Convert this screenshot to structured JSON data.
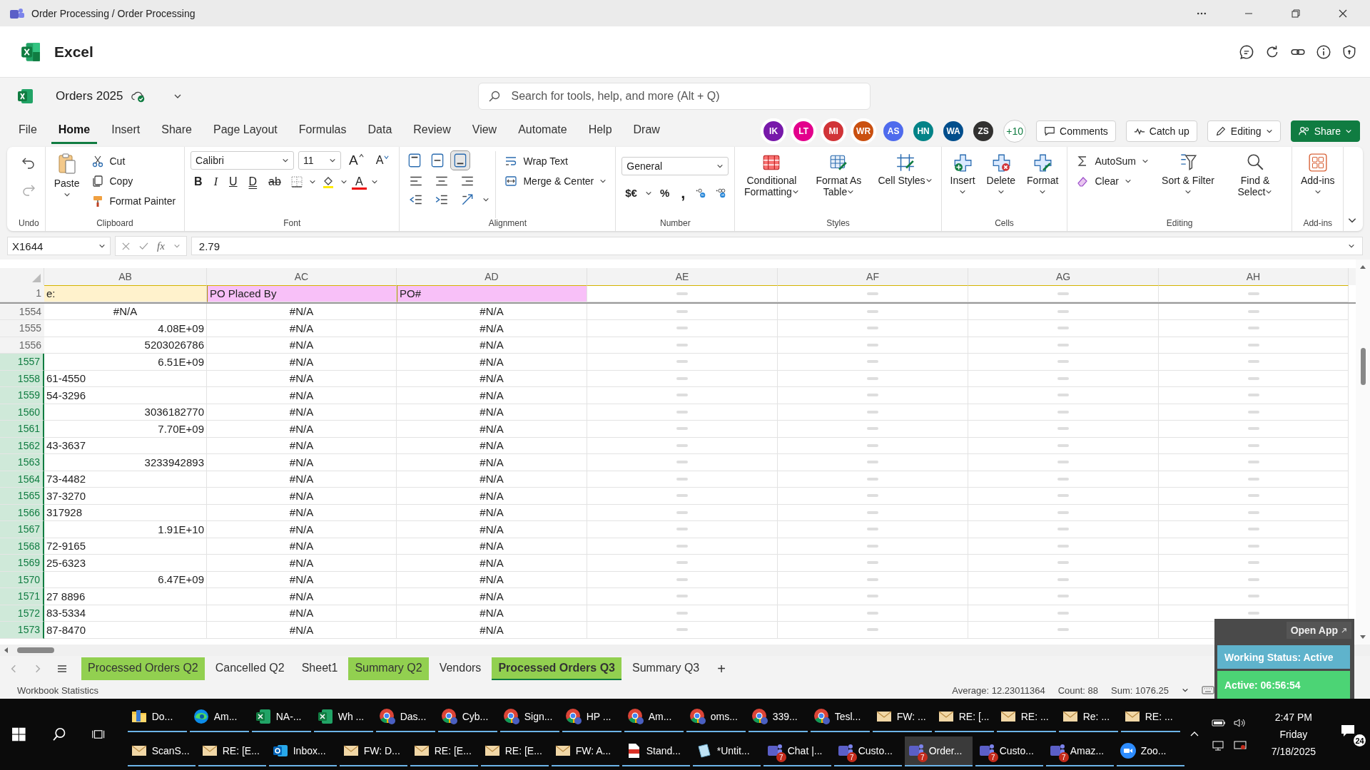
{
  "window": {
    "title": "Order Processing / Order Processing"
  },
  "app": {
    "name": "Excel"
  },
  "document": {
    "name": "Orders 2025"
  },
  "search": {
    "placeholder": "Search for tools, help, and more (Alt + Q)"
  },
  "menu_tabs": [
    {
      "label": "File",
      "selected": false
    },
    {
      "label": "Home",
      "selected": true
    },
    {
      "label": "Insert",
      "selected": false
    },
    {
      "label": "Share",
      "selected": false
    },
    {
      "label": "Page Layout",
      "selected": false
    },
    {
      "label": "Formulas",
      "selected": false
    },
    {
      "label": "Data",
      "selected": false
    },
    {
      "label": "Review",
      "selected": false
    },
    {
      "label": "View",
      "selected": false
    },
    {
      "label": "Automate",
      "selected": false
    },
    {
      "label": "Help",
      "selected": false
    },
    {
      "label": "Draw",
      "selected": false
    }
  ],
  "collaborators": [
    {
      "initials": "IK",
      "color": "#7719aa",
      "ring": true
    },
    {
      "initials": "LT",
      "color": "#e3008c",
      "ring": true
    },
    {
      "initials": "MI",
      "color": "#d13438",
      "ring": true
    },
    {
      "initials": "WR",
      "color": "#ca5010",
      "ring": true
    },
    {
      "initials": "AS",
      "color": "#4f6bed",
      "ring": false
    },
    {
      "initials": "HN",
      "color": "#038387",
      "ring": false
    },
    {
      "initials": "WA",
      "color": "#004e8c",
      "ring": false
    },
    {
      "initials": "ZS",
      "color": "#323130",
      "ring": false
    }
  ],
  "more_collaborators": "+10",
  "actions": {
    "comments": "Comments",
    "catch_up": "Catch up",
    "editing": "Editing",
    "share": "Share"
  },
  "ribbon": {
    "undo": {
      "label": "Undo"
    },
    "clipboard": {
      "label": "Clipboard",
      "paste": "Paste",
      "cut": "Cut",
      "copy": "Copy",
      "format_painter": "Format Painter"
    },
    "font": {
      "label": "Font",
      "family": "Calibri",
      "size": "11",
      "grow": "A",
      "shrink": "A",
      "styles": [
        "B",
        "I",
        "U",
        "D",
        "ab"
      ],
      "font_color": "A"
    },
    "alignment": {
      "label": "Alignment",
      "vertical": [
        {
          "selected": false
        },
        {
          "selected": false
        },
        {
          "selected": true
        }
      ],
      "wrap_text": "Wrap Text",
      "merge_center": "Merge & Center"
    },
    "number": {
      "label": "Number",
      "format": "General",
      "currency": "$€",
      "percent": "%",
      "comma": ","
    },
    "styles": {
      "label": "Styles",
      "items": [
        "Conditional Formatting",
        "Format As Table",
        "Cell Styles"
      ]
    },
    "cells": {
      "label": "Cells",
      "items": [
        "Insert",
        "Delete",
        "Format"
      ]
    },
    "editing": {
      "label": "Editing",
      "autosum": "AutoSum",
      "clear": "Clear",
      "sort_filter": "Sort & Filter",
      "find_select": "Find & Select"
    },
    "addins": {
      "label": "Add-ins",
      "button": "Add-ins"
    }
  },
  "formula_bar": {
    "name_box": "X1644",
    "fx": "fx",
    "value": "2.79"
  },
  "columns": [
    {
      "label": "AB"
    },
    {
      "label": "AC"
    },
    {
      "label": "AD"
    },
    {
      "label": "AE",
      "loading": true
    },
    {
      "label": "AF",
      "loading": true
    },
    {
      "label": "AG",
      "loading": true
    },
    {
      "label": "AH",
      "loading": true
    }
  ],
  "header_row": {
    "row": "1",
    "cells": [
      {
        "text": "e:",
        "color": "#fff2cc"
      },
      {
        "text": "PO Placed By",
        "color": "#f8c0f8"
      },
      {
        "text": "PO#",
        "color": "#f8c0f8"
      }
    ]
  },
  "rows": [
    {
      "row": "1554",
      "selected": false,
      "ab": {
        "text": "#N/A",
        "kind": "error"
      },
      "ac": "#N/A",
      "ad": "#N/A"
    },
    {
      "row": "1555",
      "selected": false,
      "ab": {
        "text": "4.08E+09",
        "kind": "number"
      },
      "ac": "#N/A",
      "ad": "#N/A"
    },
    {
      "row": "1556",
      "selected": false,
      "ab": {
        "text": "5203026786",
        "kind": "number"
      },
      "ac": "#N/A",
      "ad": "#N/A"
    },
    {
      "row": "1557",
      "selected": true,
      "ab": {
        "text": "6.51E+09",
        "kind": "number"
      },
      "ac": "#N/A",
      "ad": "#N/A"
    },
    {
      "row": "1558",
      "selected": true,
      "ab": {
        "text": "61-4550",
        "kind": "text"
      },
      "ac": "#N/A",
      "ad": "#N/A"
    },
    {
      "row": "1559",
      "selected": true,
      "ab": {
        "text": "54-3296",
        "kind": "text"
      },
      "ac": "#N/A",
      "ad": "#N/A"
    },
    {
      "row": "1560",
      "selected": true,
      "ab": {
        "text": "3036182770",
        "kind": "number"
      },
      "ac": "#N/A",
      "ad": "#N/A"
    },
    {
      "row": "1561",
      "selected": true,
      "ab": {
        "text": "7.70E+09",
        "kind": "number"
      },
      "ac": "#N/A",
      "ad": "#N/A"
    },
    {
      "row": "1562",
      "selected": true,
      "ab": {
        "text": "43-3637",
        "kind": "text"
      },
      "ac": "#N/A",
      "ad": "#N/A"
    },
    {
      "row": "1563",
      "selected": true,
      "ab": {
        "text": "3233942893",
        "kind": "number"
      },
      "ac": "#N/A",
      "ad": "#N/A"
    },
    {
      "row": "1564",
      "selected": true,
      "ab": {
        "text": "73-4482",
        "kind": "text"
      },
      "ac": "#N/A",
      "ad": "#N/A"
    },
    {
      "row": "1565",
      "selected": true,
      "ab": {
        "text": "37-3270",
        "kind": "text"
      },
      "ac": "#N/A",
      "ad": "#N/A"
    },
    {
      "row": "1566",
      "selected": true,
      "ab": {
        "text": "317928",
        "kind": "text"
      },
      "ac": "#N/A",
      "ad": "#N/A"
    },
    {
      "row": "1567",
      "selected": true,
      "ab": {
        "text": "1.91E+10",
        "kind": "number"
      },
      "ac": "#N/A",
      "ad": "#N/A"
    },
    {
      "row": "1568",
      "selected": true,
      "ab": {
        "text": "72-9165",
        "kind": "text"
      },
      "ac": "#N/A",
      "ad": "#N/A"
    },
    {
      "row": "1569",
      "selected": true,
      "ab": {
        "text": "25-6323",
        "kind": "text"
      },
      "ac": "#N/A",
      "ad": "#N/A"
    },
    {
      "row": "1570",
      "selected": true,
      "ab": {
        "text": "6.47E+09",
        "kind": "number"
      },
      "ac": "#N/A",
      "ad": "#N/A"
    },
    {
      "row": "1571",
      "selected": true,
      "ab": {
        "text": "27 8896",
        "kind": "text"
      },
      "ac": "#N/A",
      "ad": "#N/A"
    },
    {
      "row": "1572",
      "selected": true,
      "ab": {
        "text": "83-5334",
        "kind": "text"
      },
      "ac": "#N/A",
      "ad": "#N/A"
    },
    {
      "row": "1573",
      "selected": true,
      "ab": {
        "text": "87-8470",
        "kind": "text"
      },
      "ac": "#N/A",
      "ad": "#N/A"
    }
  ],
  "sheet_tabs": [
    {
      "label": "Processed Orders Q2",
      "selected": false,
      "color": "#92d050"
    },
    {
      "label": "Cancelled Q2",
      "selected": false
    },
    {
      "label": "Sheet1",
      "selected": false
    },
    {
      "label": "Summary Q2",
      "selected": false,
      "color": "#92d050"
    },
    {
      "label": "Vendors",
      "selected": false
    },
    {
      "label": "Processed Orders Q3",
      "selected": true,
      "color": "#92d050"
    },
    {
      "label": "Summary Q3",
      "selected": false
    }
  ],
  "add_sheet": "+",
  "status_bar": {
    "left": "Workbook Statistics",
    "average": "Average: 12.23011364",
    "count": "Count: 88",
    "sum": "Sum: 1076.25"
  },
  "widget": {
    "open_app": "Open App",
    "status": "Working Status: Active",
    "timer": "Active: 06:56:54"
  },
  "taskbar": {
    "upper_items": [
      {
        "label": "Do...",
        "kind": "folder",
        "selected": false
      },
      {
        "label": "Am...",
        "kind": "edge",
        "selected": false
      },
      {
        "label": "NA-...",
        "kind": "excel",
        "selected": false
      },
      {
        "label": "Wh ...",
        "kind": "excel",
        "selected": false
      },
      {
        "label": "Das...",
        "kind": "chrome",
        "selected": false
      },
      {
        "label": "Cyb...",
        "kind": "chrome",
        "selected": false
      },
      {
        "label": "Sign...",
        "kind": "chrome",
        "selected": false
      },
      {
        "label": "HP ...",
        "kind": "chrome",
        "selected": false
      },
      {
        "label": "Am...",
        "kind": "chrome",
        "selected": false
      },
      {
        "label": "oms...",
        "kind": "chrome",
        "selected": false
      },
      {
        "label": "339...",
        "kind": "chrome",
        "selected": false
      },
      {
        "label": "Tesl...",
        "kind": "chrome",
        "selected": false
      },
      {
        "label": "FW: ...",
        "kind": "mail",
        "selected": false
      },
      {
        "label": "RE: [...",
        "kind": "mail",
        "selected": false
      },
      {
        "label": "RE: ...",
        "kind": "mail",
        "selected": false
      },
      {
        "label": "Re: ...",
        "kind": "mail",
        "selected": false
      },
      {
        "label": "RE: ...",
        "kind": "mail",
        "selected": false
      }
    ],
    "lower_items": [
      {
        "label": "ScanS...",
        "kind": "mail",
        "selected": false
      },
      {
        "label": "RE: [E...",
        "kind": "mail",
        "selected": false
      },
      {
        "label": "Inbox...",
        "kind": "outlook",
        "selected": false
      },
      {
        "label": "FW: D...",
        "kind": "mail",
        "selected": false
      },
      {
        "label": "RE: [E...",
        "kind": "mail",
        "selected": false
      },
      {
        "label": "RE: [E...",
        "kind": "mail",
        "selected": false
      },
      {
        "label": "FW: A...",
        "kind": "mail",
        "selected": false
      },
      {
        "label": "Stand...",
        "kind": "pdf",
        "selected": false
      },
      {
        "label": "*Untit...",
        "kind": "notepad",
        "selected": false
      },
      {
        "label": "Chat |...",
        "kind": "teams",
        "badge": "7",
        "selected": false
      },
      {
        "label": "Custo...",
        "kind": "teams",
        "badge": "7",
        "selected": false
      },
      {
        "label": "Order...",
        "kind": "teams",
        "badge": "7",
        "selected": true
      },
      {
        "label": "Custo...",
        "kind": "teams",
        "badge": "7",
        "selected": false
      },
      {
        "label": "Amaz...",
        "kind": "teams",
        "badge": "7",
        "selected": false
      },
      {
        "label": "Zoo...",
        "kind": "zoom",
        "selected": false
      }
    ],
    "time": "2:47 PM",
    "day": "Friday",
    "date": "7/18/2025",
    "notifications": "24"
  }
}
